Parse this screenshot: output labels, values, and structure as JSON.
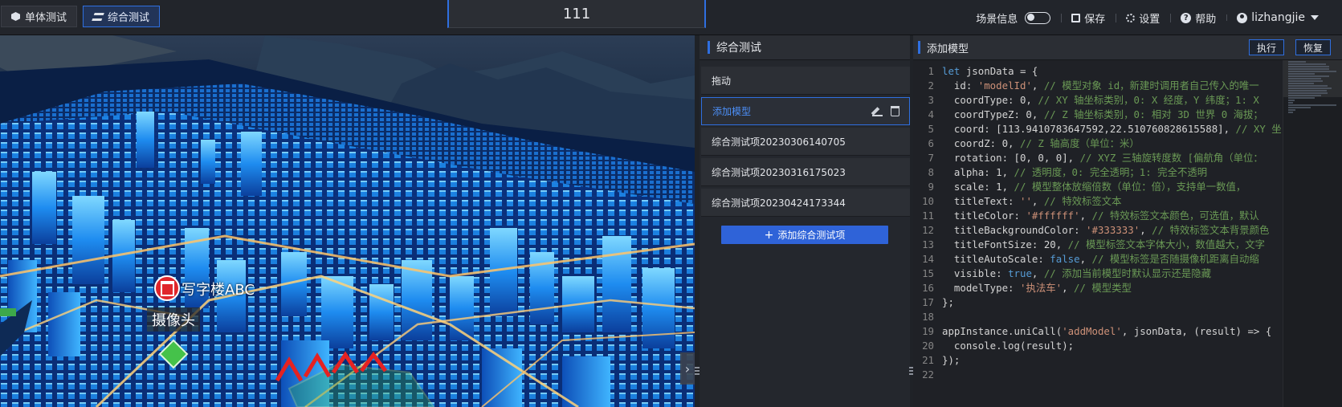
{
  "topbar": {
    "tabs": [
      {
        "label": "单体测试",
        "icon": "cube-icon"
      },
      {
        "label": "综合测试",
        "icon": "layers-icon"
      }
    ],
    "scene_name": "111",
    "scene_info_label": "场景信息",
    "save_label": "保存",
    "settings_label": "设置",
    "help_label": "帮助",
    "username": "lizhangjie"
  },
  "viewport": {
    "building_label": "写字楼ABC",
    "camera_label": "摄像头",
    "collapse_glyph": "›"
  },
  "list_panel": {
    "title": "综合测试",
    "items": [
      {
        "label": "拖动"
      },
      {
        "label": "添加模型"
      },
      {
        "label": "综合测试项20230306140705"
      },
      {
        "label": "综合测试项20230316175023"
      },
      {
        "label": "综合测试项20230424173344"
      }
    ],
    "add_button_label": "添加综合测试项",
    "add_button_icon": "+"
  },
  "code_panel": {
    "title": "添加模型",
    "run_label": "执行",
    "reset_label": "恢复",
    "lines": [
      {
        "n": "1",
        "parts": [
          [
            "kw",
            "let"
          ],
          [
            "t",
            " jsonData = {"
          ]
        ]
      },
      {
        "n": "2",
        "parts": [
          [
            "t",
            "  id: "
          ],
          [
            "str",
            "'modelId'"
          ],
          [
            "t",
            ", "
          ],
          [
            "cm",
            "// 模型对象 id，新建时调用者自己传入的唯一"
          ]
        ]
      },
      {
        "n": "3",
        "parts": [
          [
            "t",
            "  coordType: 0, "
          ],
          [
            "cm",
            "// XY 轴坐标类别，0: X 经度，Y 纬度；1: X"
          ]
        ]
      },
      {
        "n": "4",
        "parts": [
          [
            "t",
            "  coordTypeZ: 0, "
          ],
          [
            "cm",
            "// Z 轴坐标类别，0: 相对 3D 世界 0 海拔；"
          ]
        ]
      },
      {
        "n": "5",
        "parts": [
          [
            "t",
            "  coord: [113.9410783647592,22.510760828615588], "
          ],
          [
            "cm",
            "// XY 坐"
          ]
        ]
      },
      {
        "n": "6",
        "parts": [
          [
            "t",
            "  coordZ: 0, "
          ],
          [
            "cm",
            "// Z 轴高度（单位：米）"
          ]
        ]
      },
      {
        "n": "7",
        "parts": [
          [
            "t",
            "  rotation: [0, 0, 0], "
          ],
          [
            "cm",
            "// XYZ 三轴旋转度数 [偏航角（单位："
          ]
        ]
      },
      {
        "n": "8",
        "parts": [
          [
            "t",
            "  alpha: 1, "
          ],
          [
            "cm",
            "// 透明度，0: 完全透明；1: 完全不透明"
          ]
        ]
      },
      {
        "n": "9",
        "parts": [
          [
            "t",
            "  scale: 1, "
          ],
          [
            "cm",
            "// 模型整体放缩倍数（单位：倍），支持单一数值，"
          ]
        ]
      },
      {
        "n": "10",
        "parts": [
          [
            "t",
            "  titleText: "
          ],
          [
            "str",
            "''"
          ],
          [
            "t",
            ", "
          ],
          [
            "cm",
            "// 特效标签文本"
          ]
        ]
      },
      {
        "n": "11",
        "parts": [
          [
            "t",
            "  titleColor: "
          ],
          [
            "str",
            "'#ffffff'"
          ],
          [
            "t",
            ", "
          ],
          [
            "cm",
            "// 特效标签文本颜色，可选值，默认"
          ]
        ]
      },
      {
        "n": "12",
        "parts": [
          [
            "t",
            "  titleBackgroundColor: "
          ],
          [
            "str",
            "'#333333'"
          ],
          [
            "t",
            ", "
          ],
          [
            "cm",
            "// 特效标签文本背景颜色"
          ]
        ]
      },
      {
        "n": "13",
        "parts": [
          [
            "t",
            "  titleFontSize: 20, "
          ],
          [
            "cm",
            "// 模型标签文本字体大小，数值越大，文字"
          ]
        ]
      },
      {
        "n": "14",
        "parts": [
          [
            "t",
            "  titleAutoScale: "
          ],
          [
            "kw",
            "false"
          ],
          [
            "t",
            ", "
          ],
          [
            "cm",
            "// 模型标签是否随摄像机距离自动缩"
          ]
        ]
      },
      {
        "n": "15",
        "parts": [
          [
            "t",
            "  visible: "
          ],
          [
            "kw",
            "true"
          ],
          [
            "t",
            ", "
          ],
          [
            "cm",
            "// 添加当前模型时默认显示还是隐藏"
          ]
        ]
      },
      {
        "n": "16",
        "parts": [
          [
            "t",
            "  modelType: "
          ],
          [
            "str",
            "'执法车'"
          ],
          [
            "t",
            ", "
          ],
          [
            "cm",
            "// 模型类型"
          ]
        ]
      },
      {
        "n": "17",
        "parts": [
          [
            "t",
            "};"
          ]
        ]
      },
      {
        "n": "18",
        "parts": [
          [
            "t",
            ""
          ]
        ]
      },
      {
        "n": "19",
        "parts": [
          [
            "t",
            "appInstance.uniCall("
          ],
          [
            "str",
            "'addModel'"
          ],
          [
            "t",
            ", jsonData, (result) => {"
          ]
        ]
      },
      {
        "n": "20",
        "parts": [
          [
            "t",
            "  console.log(result);"
          ]
        ]
      },
      {
        "n": "21",
        "parts": [
          [
            "t",
            "});"
          ]
        ]
      },
      {
        "n": "22",
        "parts": [
          [
            "t",
            ""
          ]
        ]
      }
    ]
  }
}
